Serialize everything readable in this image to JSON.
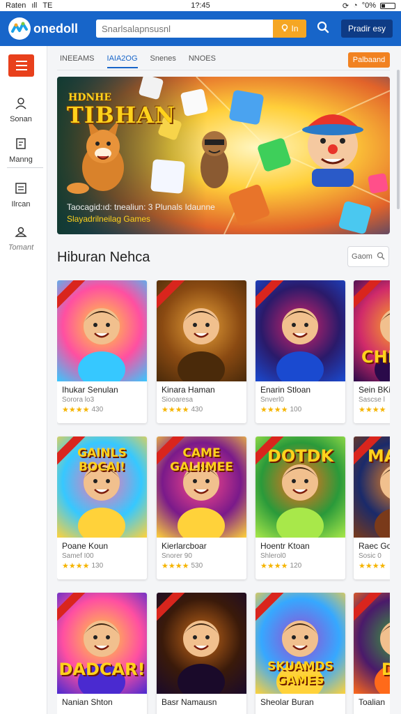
{
  "status_bar": {
    "carrier": "Raten",
    "signal": "ıll",
    "network": "TE",
    "time": "1?:45",
    "battery_text": "°0%",
    "battery_level": 0.3
  },
  "header": {
    "brand": "onedoll",
    "search_placeholder": "Snarlsalapnsusnl",
    "search_go_label": "In",
    "cta_label": "Pradir esy",
    "colors": {
      "bar": "#1765c9",
      "go": "#f5a623",
      "cta": "#0e3b85"
    }
  },
  "sidebar": {
    "items": [
      {
        "label": "Sonan",
        "icon": "user-icon"
      },
      {
        "label": "Manng",
        "icon": "document-icon"
      },
      {
        "label": "Ilrcan",
        "icon": "list-icon"
      },
      {
        "label": "Tomant",
        "icon": "user-group-icon"
      }
    ],
    "menu_color": "#e8401c"
  },
  "tabs": [
    {
      "label": "INEEAMS",
      "active": false
    },
    {
      "label": "IAIA2OG",
      "active": true
    },
    {
      "label": "Snenes",
      "active": false
    },
    {
      "label": "NNOES",
      "active": false
    }
  ],
  "toolbar": {
    "button_label": "Palbaand"
  },
  "banner": {
    "kicker": "HDNHE",
    "title": "TIBHAN",
    "caption": "Taocagid:ıd: tnealiun: 3 Plunals Idaunne",
    "subtitle": "Slayadrilneilag Games"
  },
  "section": {
    "title": "Hiburan Nehca",
    "filter_label": "Gaom"
  },
  "games": [
    {
      "name": "Ihukar Senulan",
      "meta": "Sorora lo3",
      "rating": "430",
      "stars": 4,
      "art_text": "",
      "art_colors": [
        "#ff4fa1",
        "#ffd23a",
        "#36c8ff"
      ]
    },
    {
      "name": "Kinara Haman",
      "meta": "Siooaresa",
      "rating": "430",
      "stars": 4,
      "art_text": "",
      "art_colors": [
        "#8a4a12",
        "#e8a23a",
        "#4a2a0a"
      ]
    },
    {
      "name": "Enarin Stloan",
      "meta": "Snverl0",
      "rating": "100",
      "stars": 4,
      "art_text": "",
      "art_colors": [
        "#2a1a6a",
        "#d8246a",
        "#1a4ad0"
      ]
    },
    {
      "name": "Sein BKiy",
      "meta": "Sascse l",
      "rating": "",
      "stars": 4,
      "art_text": "CHI TOL",
      "art_colors": [
        "#d02a6a",
        "#ffb020",
        "#2a0a4a"
      ]
    },
    {
      "name": "Poane Koun",
      "meta": "Samef I00",
      "rating": "130",
      "stars": 4,
      "art_text": "GAINLS BOCAI!",
      "art_colors": [
        "#36c8ff",
        "#ff6fb0",
        "#ffd23a"
      ]
    },
    {
      "name": "Kierlarcboar",
      "meta": "Snorer 90",
      "rating": "530",
      "stars": 4,
      "art_text": "CAME GALIIMEE",
      "art_colors": [
        "#7a1a8a",
        "#ff4a8a",
        "#ffd23a"
      ]
    },
    {
      "name": "Hoentr Ktoan",
      "meta": "Shlerol0",
      "rating": "120",
      "stars": 4,
      "art_text": "DOTDK",
      "art_colors": [
        "#2a9a3a",
        "#ff6a1a",
        "#a8e84a"
      ]
    },
    {
      "name": "Raec God",
      "meta": "Sosic 0",
      "rating": "",
      "stars": 4,
      "art_text": "MA DA",
      "art_colors": [
        "#1a2a6a",
        "#ff8a1a",
        "#7a3a1a"
      ]
    },
    {
      "name": "Nanian Shton",
      "meta": "",
      "rating": "",
      "stars": 0,
      "art_text": "DADCAR!",
      "art_colors": [
        "#ff4fa1",
        "#ffd23a",
        "#4a2ad0"
      ]
    },
    {
      "name": "Basr Namausn",
      "meta": "",
      "rating": "",
      "stars": 0,
      "art_text": "",
      "art_colors": [
        "#3a1a0a",
        "#c86a1a",
        "#1a0a2a"
      ]
    },
    {
      "name": "Sheolar Buran",
      "meta": "",
      "rating": "",
      "stars": 0,
      "art_text": "SKUAMDS GAMES",
      "art_colors": [
        "#36a8ff",
        "#9a4ad0",
        "#ffd23a"
      ]
    },
    {
      "name": "Toalian",
      "meta": "",
      "rating": "",
      "stars": 0,
      "art_text": "DOI",
      "art_colors": [
        "#4a1a6a",
        "#3aa83a",
        "#ff6a1a"
      ]
    }
  ]
}
